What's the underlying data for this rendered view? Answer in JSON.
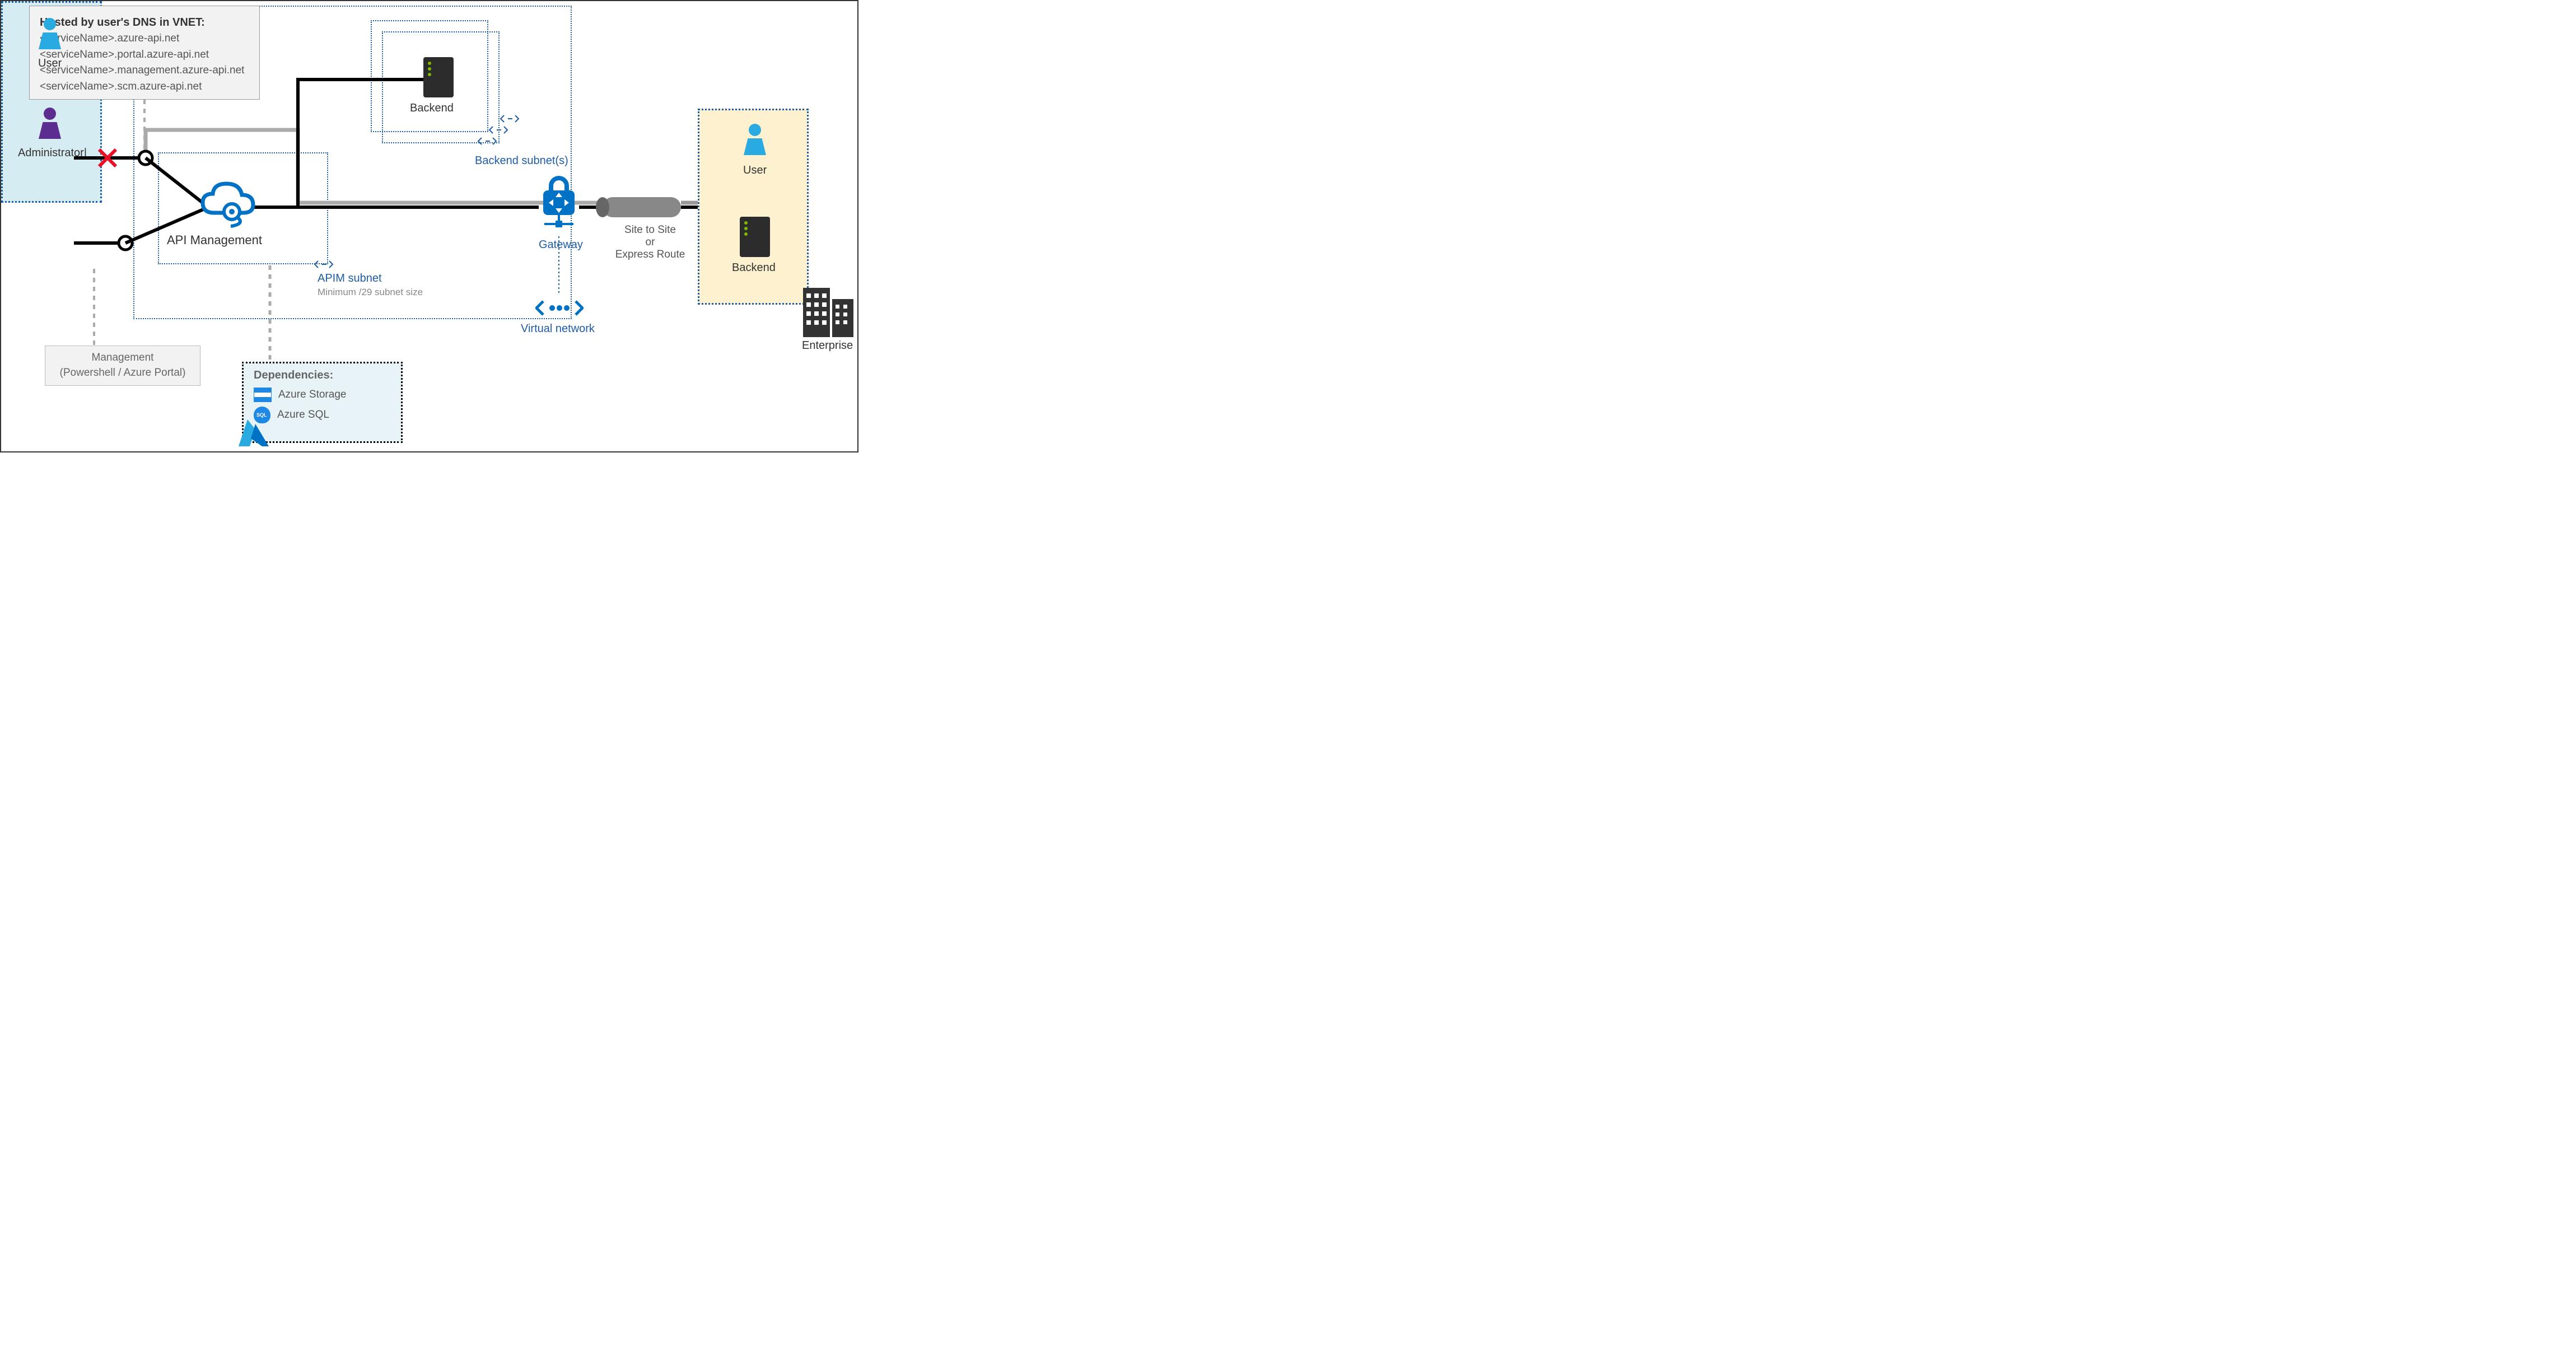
{
  "dns": {
    "title": "Hosted by user's DNS in VNET:",
    "lines": [
      "<serviceName>.azure-api.net",
      "<serviceName>.portal.azure-api.net",
      "<serviceName>.management.azure-api.net",
      "<serviceName>.scm.azure-api.net"
    ]
  },
  "roles": {
    "user": "User",
    "admin": "Administrator|",
    "user2": "User",
    "backend": "Backend",
    "backend2": "Backend",
    "enterprise": "Enterprise"
  },
  "labels": {
    "apim": "API Management",
    "apim_subnet": "APIM subnet",
    "apim_subnet_note": "Minimum /29 subnet size",
    "backend_subnets": "Backend subnet(s)",
    "gateway": "Gateway",
    "vnet": "Virtual network",
    "s2s": "Site to Site\nor\nExpress Route"
  },
  "mgmt": {
    "line1": "Management",
    "line2": "(Powershell / Azure Portal)"
  },
  "deps": {
    "title": "Dependencies:",
    "storage": "Azure Storage",
    "sql": "Azure SQL"
  }
}
